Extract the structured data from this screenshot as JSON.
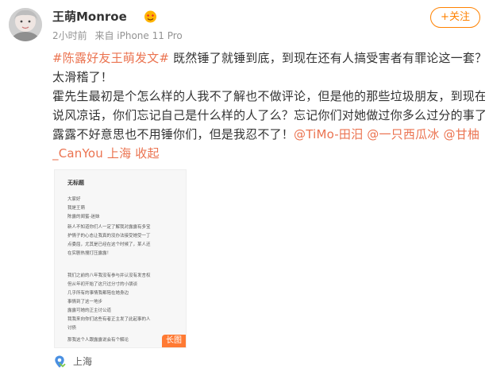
{
  "post": {
    "username": "王萌Monroe",
    "time": "2小时前",
    "source": "来自 iPhone 11 Pro",
    "follow_label": "+关注",
    "text": {
      "l1_topic": "#陈露好友王萌发文#",
      "l1_rest": " 既然锤了就锤到底，到现在还有人搞受害者有罪论这一套？真的",
      "l2": "太滑稽了！",
      "l3": "霍先生最初是个怎么样的人我不了解也不做评论，但是他的那些垃圾朋友，到现在还在",
      "l4": "说风凉话，你们忘记自己是什么样的人了么？忘记你们对她做过你多么过分的事了么？",
      "l5_text": "露露不好意思也不用锤你们，但是我忍不了！",
      "l5_mention1": "@TiMo-田汨",
      "l5_mention2": "@一只西瓜冰",
      "l5_mention3": "@甘柚",
      "l6_mention": "_CanYou",
      "l6_location": "上海",
      "l6_collapse": "收起"
    },
    "image": {
      "title": "无标题",
      "lines": [
        "大家好",
        "我是王萌",
        "陈露的闺蜜-迷妹",
        "新人不知道你们人一定了解我对露露有多宝",
        "护情子的心态让我真的没办法接受她受一丁",
        "点委屈，尤其是已经在这个时候了，某人还",
        "在实剧热搜打压露露！",
        "",
        "我们之前的八年我没有参与并认没有发言权",
        "但从年初开始了这只过分寸的小朋谈",
        "几乎所有的事情我都陪在她身边",
        "事情到了这一地步",
        "露露可她的正主讨公道",
        "我我来向你们这些有者正主发了此起事的人",
        "讨债",
        "那我这个人跟露露说会有个解论"
      ],
      "badge": "长图"
    },
    "location_label": "上海"
  },
  "colors": {
    "accent": "#ff8200",
    "link": "#eb7350",
    "text": "#333333",
    "meta": "#939393"
  },
  "icons": {
    "vip": "vip-heart-eyes-icon",
    "location": "location-pin-icon"
  }
}
